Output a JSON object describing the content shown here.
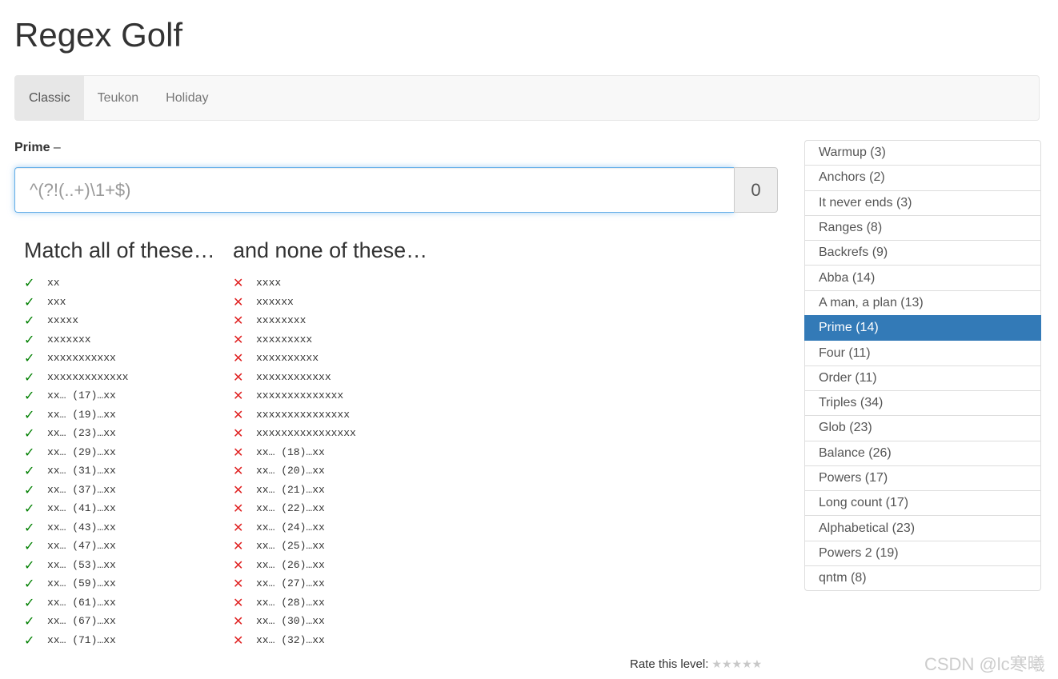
{
  "page_title": "Regex Golf",
  "nav": {
    "tabs": [
      {
        "label": "Classic",
        "active": true
      },
      {
        "label": "Teukon",
        "active": false
      },
      {
        "label": "Holiday",
        "active": false
      }
    ]
  },
  "level": {
    "name": "Prime",
    "dash": "–"
  },
  "regex": {
    "placeholder": "^(?!(..+)\\1+$)",
    "value": "",
    "score": "0"
  },
  "match": {
    "heading": "Match all of these…",
    "items": [
      "xx",
      "xxx",
      "xxxxx",
      "xxxxxxx",
      "xxxxxxxxxxx",
      "xxxxxxxxxxxxx",
      "xx… (17)…xx",
      "xx… (19)…xx",
      "xx… (23)…xx",
      "xx… (29)…xx",
      "xx… (31)…xx",
      "xx… (37)…xx",
      "xx… (41)…xx",
      "xx… (43)…xx",
      "xx… (47)…xx",
      "xx… (53)…xx",
      "xx… (59)…xx",
      "xx… (61)…xx",
      "xx… (67)…xx",
      "xx… (71)…xx"
    ]
  },
  "nomatch": {
    "heading": "and none of these…",
    "items": [
      "xxxx",
      "xxxxxx",
      "xxxxxxxx",
      "xxxxxxxxx",
      "xxxxxxxxxx",
      "xxxxxxxxxxxx",
      "xxxxxxxxxxxxxx",
      "xxxxxxxxxxxxxxx",
      "xxxxxxxxxxxxxxxx",
      "xx… (18)…xx",
      "xx… (20)…xx",
      "xx… (21)…xx",
      "xx… (22)…xx",
      "xx… (24)…xx",
      "xx… (25)…xx",
      "xx… (26)…xx",
      "xx… (27)…xx",
      "xx… (28)…xx",
      "xx… (30)…xx",
      "xx… (32)…xx"
    ]
  },
  "marks": {
    "check_glyph": "✓",
    "cross_glyph": "✕",
    "check_color": "#008000",
    "cross_color": "#e02424"
  },
  "levels": [
    {
      "label": "Warmup (3)",
      "active": false
    },
    {
      "label": "Anchors (2)",
      "active": false
    },
    {
      "label": "It never ends (3)",
      "active": false
    },
    {
      "label": "Ranges (8)",
      "active": false
    },
    {
      "label": "Backrefs (9)",
      "active": false
    },
    {
      "label": "Abba (14)",
      "active": false
    },
    {
      "label": "A man, a plan (13)",
      "active": false
    },
    {
      "label": "Prime (14)",
      "active": true
    },
    {
      "label": "Four (11)",
      "active": false
    },
    {
      "label": "Order (11)",
      "active": false
    },
    {
      "label": "Triples (34)",
      "active": false
    },
    {
      "label": "Glob (23)",
      "active": false
    },
    {
      "label": "Balance (26)",
      "active": false
    },
    {
      "label": "Powers (17)",
      "active": false
    },
    {
      "label": "Long count (17)",
      "active": false
    },
    {
      "label": "Alphabetical (23)",
      "active": false
    },
    {
      "label": "Powers 2 (19)",
      "active": false
    },
    {
      "label": "qntm (8)",
      "active": false
    }
  ],
  "rating": {
    "label": "Rate this level:",
    "stars": [
      "★",
      "★",
      "★",
      "★",
      "★"
    ],
    "value": 0
  },
  "watermark": "CSDN @lc寒曦",
  "colors": {
    "active_level_bg": "#337ab7",
    "input_focus_border": "#66afe9"
  }
}
